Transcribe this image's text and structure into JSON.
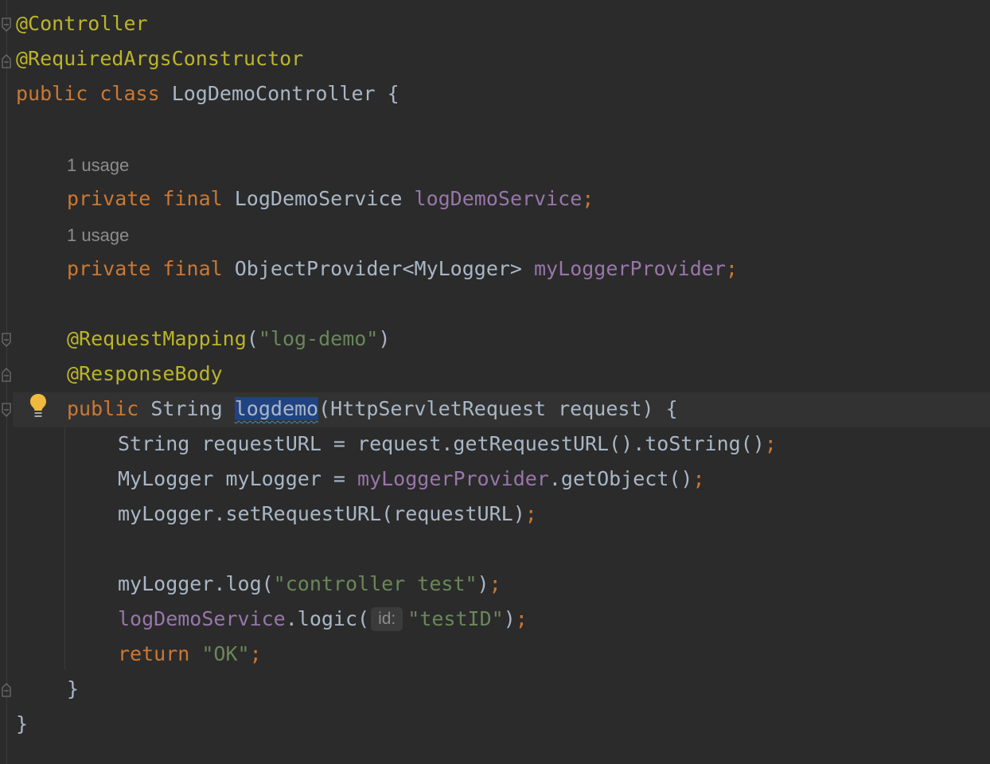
{
  "editor": {
    "usage_hints": [
      "1 usage",
      "1 usage"
    ],
    "lines": {
      "l1_ann": "@Controller",
      "l2_ann": "@RequiredArgsConstructor",
      "l3_kw1": "public",
      "l3_kw2": "class",
      "l3_name": "LogDemoController",
      "l3_brace": "{",
      "l4_kw1": "private",
      "l4_kw2": "final",
      "l4_type": "LogDemoService",
      "l4_field": "logDemoService",
      "l4_semi": ";",
      "l5_kw1": "private",
      "l5_kw2": "final",
      "l5_type": "ObjectProvider<MyLogger>",
      "l5_field": "myLoggerProvider",
      "l5_semi": ";",
      "l6_ann": "@RequestMapping",
      "l6_open": "(",
      "l6_str": "\"log-demo\"",
      "l6_close": ")",
      "l7_ann": "@ResponseBody",
      "l8_kw": "public",
      "l8_type": "String",
      "l8_method": "logdemo",
      "l8_params": "(HttpServletRequest request) {",
      "l9_code": "String requestURL = request.getRequestURL().toString()",
      "l9_semi": ";",
      "l10_code1": "MyLogger myLogger = ",
      "l10_field": "myLoggerProvider",
      "l10_code2": ".getObject()",
      "l10_semi": ";",
      "l11_code": "myLogger.setRequestURL(requestURL)",
      "l11_semi": ";",
      "l12_code1": "myLogger.log(",
      "l12_str": "\"controller test\"",
      "l12_code2": ")",
      "l12_semi": ";",
      "l13_field": "logDemoService",
      "l13_code1": ".logic(",
      "l13_hint": "id:",
      "l13_str": "\"testID\"",
      "l13_code2": ")",
      "l13_semi": ";",
      "l14_kw": "return",
      "l14_str": "\"OK\"",
      "l14_semi": ";",
      "l15_brace": "}",
      "l16_brace": "}"
    },
    "icons": [
      "fold-icon",
      "lightbulb-icon"
    ],
    "colors": {
      "background": "#2b2b2b",
      "keyword": "#cc7832",
      "annotation": "#bbb529",
      "field": "#9876aa",
      "string": "#6a8759",
      "text": "#a9b7c6",
      "hint": "#8c8c8c",
      "selection": "#214283"
    }
  }
}
